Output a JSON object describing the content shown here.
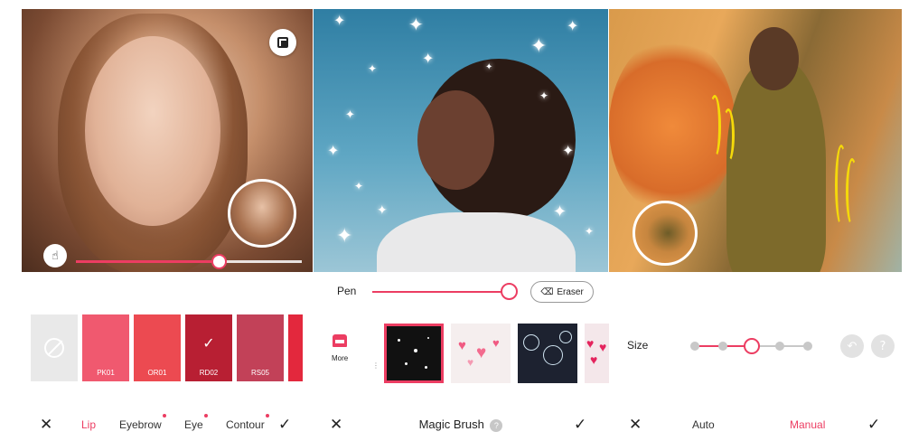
{
  "panel_lip": {
    "swatches": [
      {
        "label": "",
        "color": "#e9e9e9",
        "type": "none"
      },
      {
        "label": "PK01",
        "color": "#f0596f",
        "type": "color"
      },
      {
        "label": "OR01",
        "color": "#ec4a51",
        "type": "color"
      },
      {
        "label": "RD02",
        "color": "#b81f33",
        "type": "color",
        "selected": true
      },
      {
        "label": "RS05",
        "color": "#c24158",
        "type": "color"
      },
      {
        "label": "",
        "color": "#e3283d",
        "type": "color"
      }
    ],
    "intensity": 0.63,
    "bottom": {
      "tabs": [
        "Lip",
        "Eyebrow",
        "Eye",
        "Contour"
      ],
      "active_tab": "Lip"
    }
  },
  "panel_magic": {
    "pen_label": "Pen",
    "pen_value": 0.95,
    "eraser_label": "Eraser",
    "more_label": "More",
    "brushes": [
      {
        "name": "stars",
        "selected": true
      },
      {
        "name": "hearts",
        "selected": false
      },
      {
        "name": "bubbles",
        "selected": false
      },
      {
        "name": "hearts-2",
        "selected": false
      }
    ],
    "title": "Magic Brush",
    "help_text": "?"
  },
  "panel_size": {
    "size_label": "Size",
    "size_steps": 5,
    "size_selected_index": 2,
    "auto_label": "Auto",
    "manual_label": "Manual",
    "active_mode": "Manual"
  },
  "colors": {
    "accent": "#ec3d62",
    "text": "#222222",
    "muted": "#c8c8c8"
  },
  "icons": [
    "close-icon",
    "check-icon",
    "compare-icon",
    "touch-icon",
    "eraser-icon",
    "store-icon",
    "undo-icon",
    "help-icon"
  ]
}
